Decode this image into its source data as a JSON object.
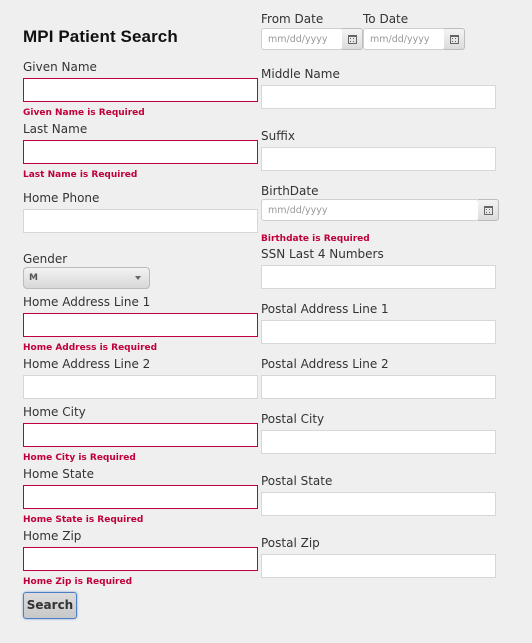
{
  "page": {
    "title": "MPI Patient Search",
    "search_button": "Search"
  },
  "date_range": {
    "from_label": "From Date",
    "to_label": "To Date",
    "placeholder": "mm/dd/yyyy"
  },
  "left": {
    "given_name": {
      "label": "Given Name",
      "value": "",
      "error": "Given Name is Required"
    },
    "last_name": {
      "label": "Last Name",
      "value": "",
      "error": "Last Name is Required"
    },
    "home_phone": {
      "label": "Home Phone",
      "value": ""
    },
    "gender": {
      "label": "Gender",
      "value": "M"
    },
    "home_address_1": {
      "label": "Home Address Line 1",
      "value": "",
      "error": "Home Address is Required"
    },
    "home_address_2": {
      "label": "Home Address Line 2",
      "value": ""
    },
    "home_city": {
      "label": "Home City",
      "value": "",
      "error": "Home City is Required"
    },
    "home_state": {
      "label": "Home State",
      "value": "",
      "error": "Home State is Required"
    },
    "home_zip": {
      "label": "Home Zip",
      "value": "",
      "error": "Home Zip is Required"
    }
  },
  "right": {
    "middle_name": {
      "label": "Middle Name",
      "value": ""
    },
    "suffix": {
      "label": "Suffix",
      "value": ""
    },
    "birthdate": {
      "label": "BirthDate",
      "placeholder": "mm/dd/yyyy",
      "error": "Birthdate is Required"
    },
    "ssn_last4": {
      "label": "SSN Last 4 Numbers",
      "value": ""
    },
    "postal_address_1": {
      "label": "Postal Address Line 1",
      "value": ""
    },
    "postal_address_2": {
      "label": "Postal Address Line 2",
      "value": ""
    },
    "postal_city": {
      "label": "Postal City",
      "value": ""
    },
    "postal_state": {
      "label": "Postal State",
      "value": ""
    },
    "postal_zip": {
      "label": "Postal Zip",
      "value": ""
    }
  },
  "colors": {
    "error": "#c0003b",
    "background": "#efefef",
    "button_border": "#4d7fc7"
  },
  "icons": {
    "calendar": "calendar-icon",
    "dropdown": "chevron-down-icon"
  }
}
